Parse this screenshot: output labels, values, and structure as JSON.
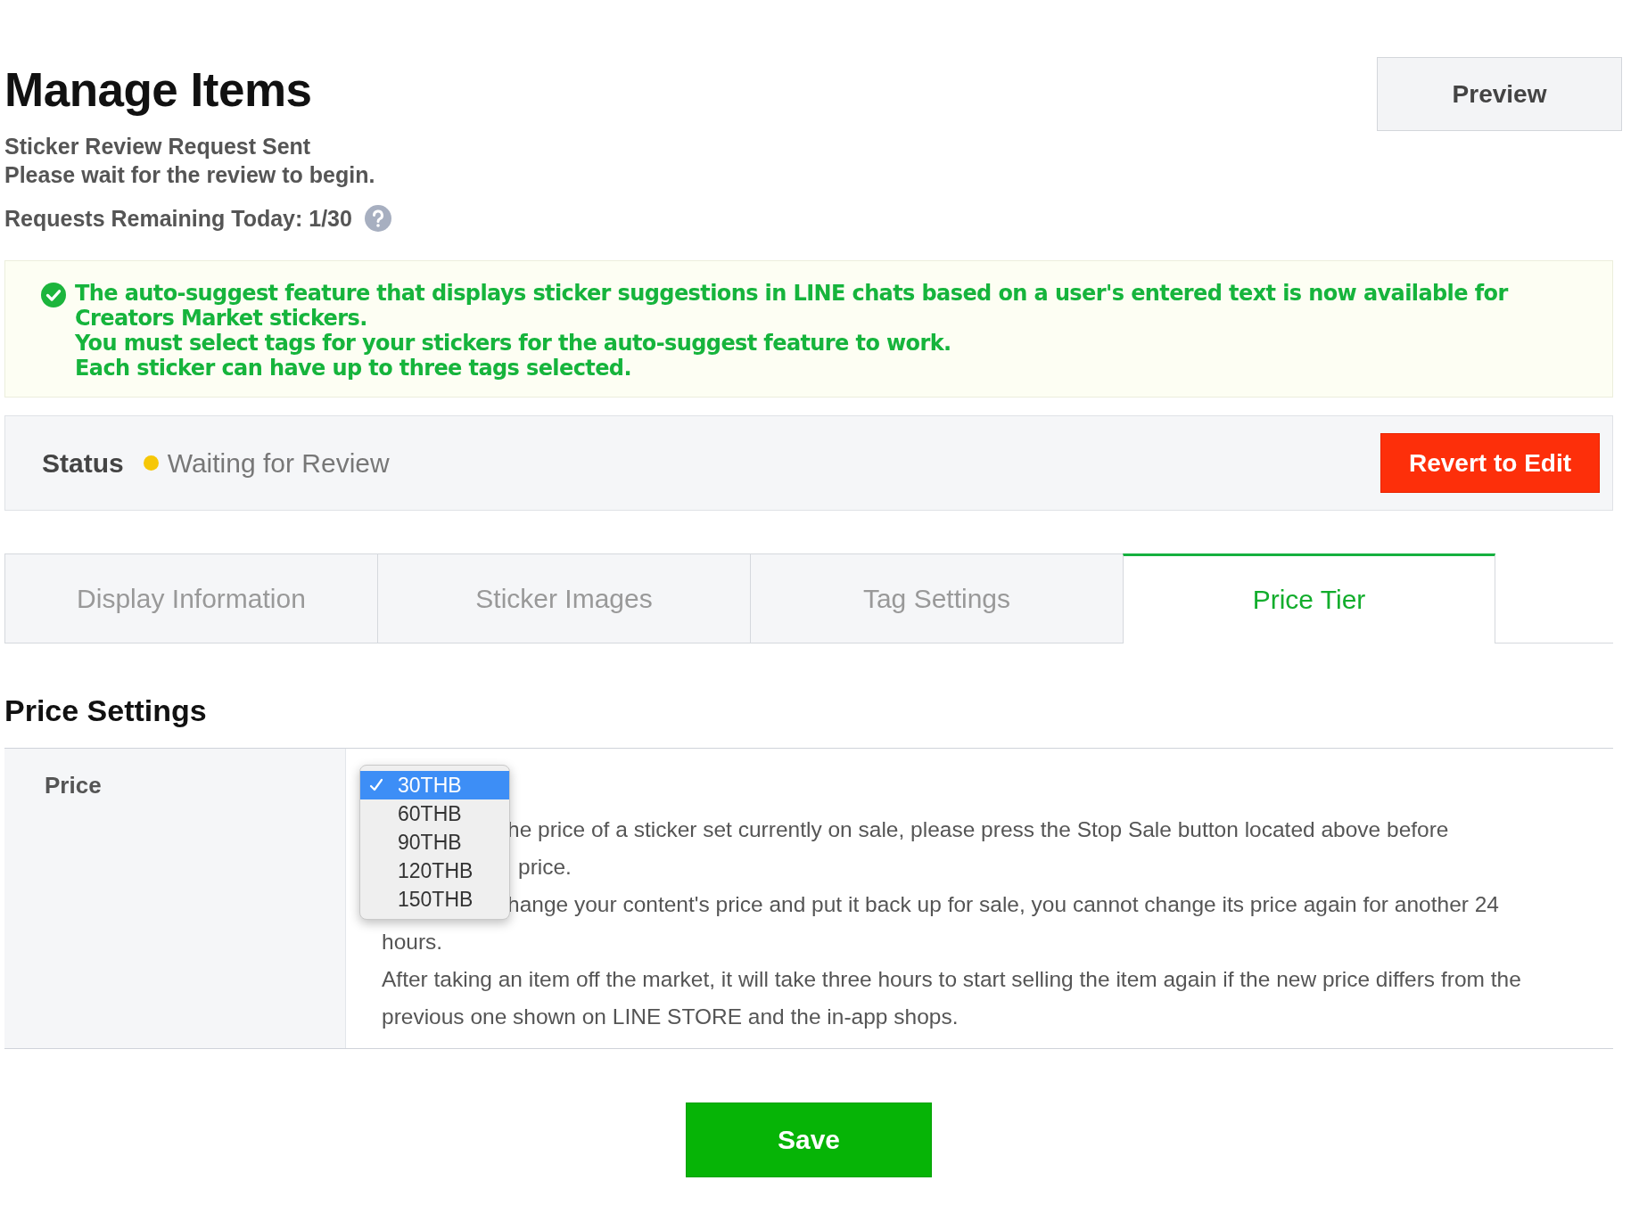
{
  "header": {
    "title": "Manage Items",
    "preview_button": "Preview"
  },
  "review_status": {
    "heading": "Sticker Review Request Sent",
    "message": "Please wait for the review to begin."
  },
  "requests_remaining": "Requests Remaining Today: 1/30",
  "notice": {
    "lines": [
      "The auto-suggest feature that displays sticker suggestions in LINE chats based on a user's entered text is now available for Creators Market stickers.",
      "You must select tags for your stickers for the auto-suggest feature to work.",
      "Each sticker can have up to three tags selected."
    ]
  },
  "status": {
    "label": "Status",
    "value": "Waiting for Review",
    "revert_button": "Revert to Edit"
  },
  "tabs": [
    {
      "label": "Display Information",
      "selected": false
    },
    {
      "label": "Sticker Images",
      "selected": false
    },
    {
      "label": "Tag Settings",
      "selected": false
    },
    {
      "label": "Price Tier",
      "selected": true
    }
  ],
  "section_title": "Price Settings",
  "price_row": {
    "label": "Price",
    "dropdown": {
      "options": [
        {
          "label": "30THB",
          "selected": true
        },
        {
          "label": "60THB",
          "selected": false
        },
        {
          "label": "90THB",
          "selected": false
        },
        {
          "label": "120THB",
          "selected": false
        },
        {
          "label": "150THB",
          "selected": false
        }
      ]
    },
    "notes": [
      {
        "kind": "covered",
        "text": "he price of a sticker set currently on sale, please press the Stop Sale button located above before"
      },
      {
        "kind": "covered-short",
        "text": "price."
      },
      {
        "kind": "covered",
        "text": "hange your content's price and put it back up for sale, you cannot change its price again for another 24"
      },
      {
        "kind": "full",
        "text": "hours."
      },
      {
        "kind": "full",
        "text": "After taking an item off the market, it will take three hours to start selling the item again if the new price differs from the previous one shown on LINE STORE and the in-app shops."
      }
    ]
  },
  "save_button": "Save"
}
